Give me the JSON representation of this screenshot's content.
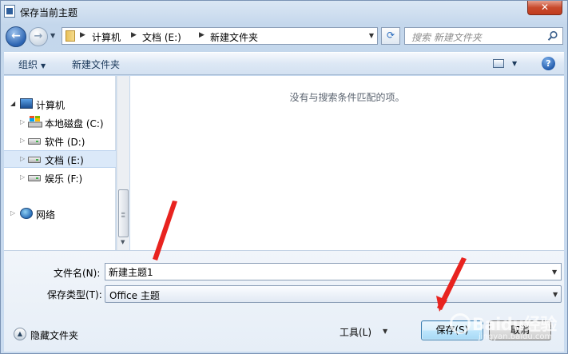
{
  "window": {
    "title": "保存当前主题",
    "close_label": "✕"
  },
  "address_bar": {
    "breadcrumbs": [
      "计算机",
      "文档 (E:)",
      "新建文件夹"
    ]
  },
  "search": {
    "placeholder": "搜索 新建文件夹"
  },
  "toolbar": {
    "organize_label": "组织",
    "new_folder_label": "新建文件夹",
    "help_label": "?"
  },
  "nav_tree": {
    "computer": "计算机",
    "drives": [
      {
        "label": "本地磁盘 (C:)"
      },
      {
        "label": "软件 (D:)"
      },
      {
        "label": "文档 (E:)",
        "selected": true
      },
      {
        "label": "娱乐 (F:)"
      }
    ],
    "network": "网络"
  },
  "content": {
    "empty_message": "没有与搜索条件匹配的项。"
  },
  "form": {
    "filename_label": "文件名(N):",
    "filename_value": "新建主题1",
    "type_label": "保存类型(T):",
    "type_value": "Office 主题"
  },
  "footer": {
    "hide_folders_label": "隐藏文件夹",
    "tools_label": "工具(L)",
    "save_label": "保存(S)",
    "cancel_label": "取消"
  },
  "watermark": {
    "text": "Baidu经验",
    "sub": "jingyan.baidu.com"
  },
  "colors": {
    "accent": "#2c64b2",
    "annotation_arrow": "#e8231f",
    "selected_row": "#dbe9f9"
  }
}
